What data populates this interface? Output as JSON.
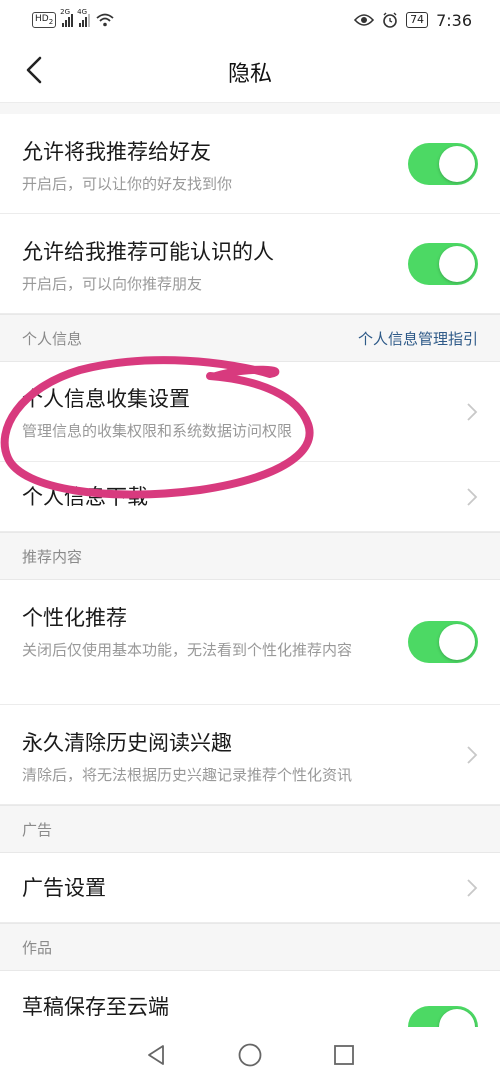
{
  "status_bar": {
    "hd_label": "HD",
    "hd_sub": "2",
    "net1": "2G",
    "net2": "4G",
    "battery": "74",
    "time": "7:36"
  },
  "header": {
    "title": "隐私"
  },
  "rows": {
    "recommend_to_friends": {
      "title": "允许将我推荐给好友",
      "subtitle": "开启后，可以让你的好友找到你",
      "toggle_on": true
    },
    "recommend_known": {
      "title": "允许给我推荐可能认识的人",
      "subtitle": "开启后，可以向你推荐朋友",
      "toggle_on": true
    },
    "collection_settings": {
      "title": "个人信息收集设置",
      "subtitle": "管理信息的收集权限和系统数据访问权限"
    },
    "download": {
      "title": "个人信息下载"
    },
    "personalized": {
      "title": "个性化推荐",
      "subtitle": "关闭后仅使用基本功能，无法看到个性化推荐内容",
      "toggle_on": true
    },
    "clear_history": {
      "title": "永久清除历史阅读兴趣",
      "subtitle": "清除后，将无法根据历史兴趣记录推荐个性化资讯"
    },
    "ad_settings": {
      "title": "广告设置"
    },
    "draft_cloud": {
      "title": "草稿保存至云端",
      "toggle_on": true
    }
  },
  "sections": {
    "personal_info": {
      "label": "个人信息",
      "link": "个人信息管理指引"
    },
    "recommend_content": {
      "label": "推荐内容"
    },
    "ads": {
      "label": "广告"
    },
    "works": {
      "label": "作品"
    }
  },
  "colors": {
    "toggle_on": "#4cd964",
    "link": "#2e5a88",
    "annotation": "#d83a7e"
  }
}
